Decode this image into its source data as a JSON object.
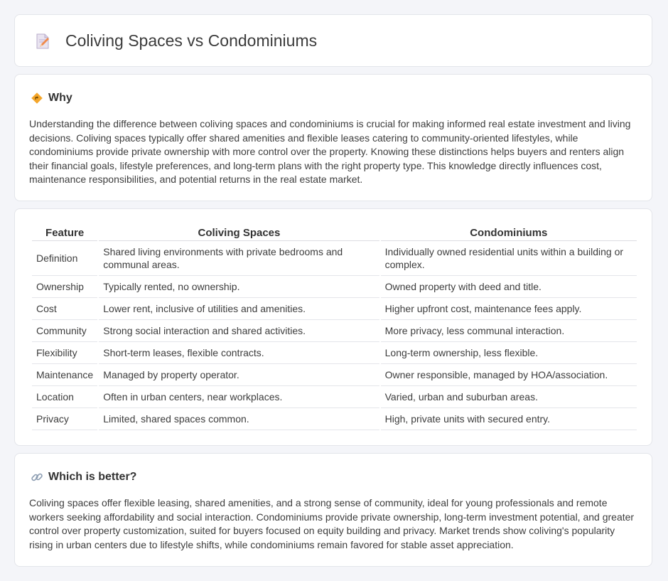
{
  "header": {
    "title": "Coliving Spaces vs Condominiums",
    "icon": "document-pencil-icon"
  },
  "why": {
    "heading": "Why",
    "icon": "road-sign-icon",
    "text": "Understanding the difference between coliving spaces and condominiums is crucial for making informed real estate investment and living decisions. Coliving spaces typically offer shared amenities and flexible leases catering to community-oriented lifestyles, while condominiums provide private ownership with more control over the property. Knowing these distinctions helps buyers and renters align their financial goals, lifestyle preferences, and long-term plans with the right property type. This knowledge directly influences cost, maintenance responsibilities, and potential returns in the real estate market."
  },
  "table": {
    "headers": [
      "Feature",
      "Coliving Spaces",
      "Condominiums"
    ],
    "rows": [
      [
        "Definition",
        "Shared living environments with private bedrooms and communal areas.",
        "Individually owned residential units within a building or complex."
      ],
      [
        "Ownership",
        "Typically rented, no ownership.",
        "Owned property with deed and title."
      ],
      [
        "Cost",
        "Lower rent, inclusive of utilities and amenities.",
        "Higher upfront cost, maintenance fees apply."
      ],
      [
        "Community",
        "Strong social interaction and shared activities.",
        "More privacy, less communal interaction."
      ],
      [
        "Flexibility",
        "Short-term leases, flexible contracts.",
        "Long-term ownership, less flexible."
      ],
      [
        "Maintenance",
        "Managed by property operator.",
        "Owner responsible, managed by HOA/association."
      ],
      [
        "Location",
        "Often in urban centers, near workplaces.",
        "Varied, urban and suburban areas."
      ],
      [
        "Privacy",
        "Limited, shared spaces common.",
        "High, private units with secured entry."
      ]
    ]
  },
  "better": {
    "heading": "Which is better?",
    "icon": "link-icon",
    "text": "Coliving spaces offer flexible leasing, shared amenities, and a strong sense of community, ideal for young professionals and remote workers seeking affordability and social interaction. Condominiums provide private ownership, long-term investment potential, and greater control over property customization, suited for buyers focused on equity building and privacy. Market trends show coliving's popularity rising in urban centers due to lifestyle shifts, while condominiums remain favored for stable asset appreciation."
  }
}
